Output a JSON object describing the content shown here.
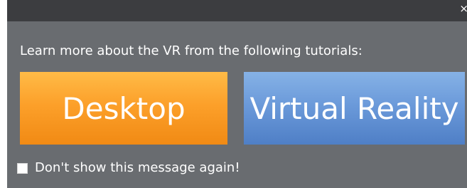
{
  "dialog": {
    "close_label": "×",
    "message": "Learn more about the VR from the following tutorials:",
    "buttons": {
      "desktop": "Desktop",
      "vr": "Virtual Reality"
    },
    "dont_show_again": "Don't show this message again!",
    "dont_show_again_checked": false
  },
  "colors": {
    "title_bar": "#3c3d40",
    "dialog_background": "#696c70",
    "desktop_button": "#fca02a",
    "vr_button": "#6b9ada",
    "text": "#ffffff"
  },
  "icons": {
    "close": "close-icon",
    "checkbox": "checkbox-unchecked"
  }
}
